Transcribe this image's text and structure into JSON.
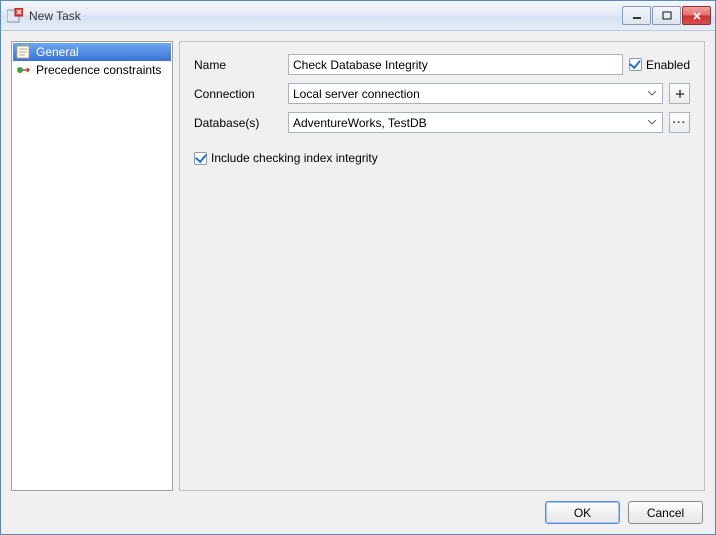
{
  "window": {
    "title": "New Task"
  },
  "sidebar": {
    "items": [
      {
        "label": "General",
        "selected": true
      },
      {
        "label": "Precedence constraints",
        "selected": false
      }
    ]
  },
  "form": {
    "name_label": "Name",
    "name_value": "Check Database Integrity",
    "enabled_label": "Enabled",
    "enabled_checked": true,
    "connection_label": "Connection",
    "connection_value": "Local server connection",
    "databases_label": "Database(s)",
    "databases_value": "AdventureWorks, TestDB",
    "index_integrity_label": "Include checking index integrity",
    "index_integrity_checked": true
  },
  "buttons": {
    "ok": "OK",
    "cancel": "Cancel"
  }
}
